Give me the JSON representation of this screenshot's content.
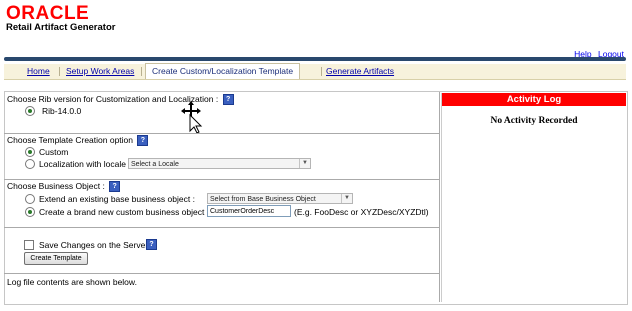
{
  "header": {
    "logo": "ORACLE",
    "app_title": "Retail Artifact Generator",
    "links": {
      "help": "Help",
      "logout": "Logout"
    }
  },
  "tabs": [
    {
      "label": "Home",
      "active": false
    },
    {
      "label": "Setup Work Areas",
      "active": false
    },
    {
      "label": "Create Custom/Localization Template",
      "active": true
    },
    {
      "label": "Generate Artifacts",
      "active": false
    }
  ],
  "rib": {
    "label": "Choose Rib version for Customization and Localization :",
    "option": "Rib-14.0.0",
    "selected": true
  },
  "template_option": {
    "label": "Choose Template Creation option",
    "custom_label": "Custom",
    "custom_selected": true,
    "localization_label": "Localization with locale",
    "localization_selected": false,
    "locale_select": "Select a Locale"
  },
  "business_object": {
    "label": "Choose Business Object :",
    "extend_label": "Extend an existing base business object :",
    "extend_selected": false,
    "base_select": "Select from Base Business Object",
    "new_label": "Create a brand new custom business object :",
    "new_selected": true,
    "new_value": "CustomerOrderDesc",
    "example": "(E.g. FooDesc or XYZDesc/XYZDtl)"
  },
  "save": {
    "checkbox_label": "Save Changes on the Server",
    "checked": false,
    "button": "Create Template"
  },
  "log": {
    "text": "Log file contents are shown below."
  },
  "activity_log": {
    "title": "Activity Log",
    "message": "No Activity Recorded"
  },
  "colors": {
    "brand_red": "#ff0000",
    "header_rule": "#29486d",
    "tabbar_bg": "#f7f2dc",
    "link_blue": "#0000ee"
  }
}
